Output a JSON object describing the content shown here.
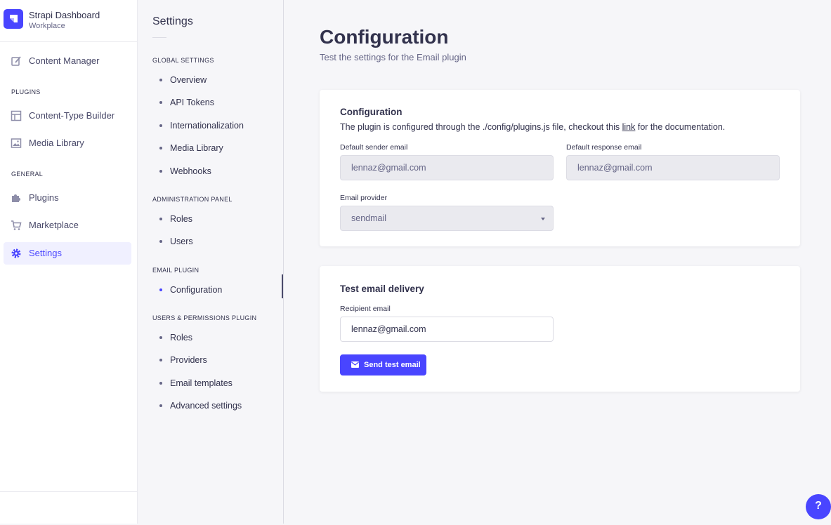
{
  "brand": {
    "title": "Strapi Dashboard",
    "subtitle": "Workplace",
    "icon": "strapi-logo-icon"
  },
  "mainnav": {
    "content_manager": "Content Manager",
    "plugins_section": "Plugins",
    "content_type_builder": "Content-Type Builder",
    "media_library": "Media Library",
    "general_section": "General",
    "plugins": "Plugins",
    "marketplace": "Marketplace",
    "settings": "Settings",
    "active": "Settings"
  },
  "subnav": {
    "title": "Settings",
    "global_section": "Global Settings",
    "overview": "Overview",
    "api_tokens": "API Tokens",
    "internationalization": "Internationalization",
    "media_library": "Media Library",
    "webhooks": "Webhooks",
    "admin_section": "Administration Panel",
    "admin_roles": "Roles",
    "admin_users": "Users",
    "email_section": "Email Plugin",
    "email_configuration": "Configuration",
    "up_section": "Users & Permissions Plugin",
    "up_roles": "Roles",
    "up_providers": "Providers",
    "up_email_templates": "Email templates",
    "up_advanced": "Advanced settings"
  },
  "page": {
    "title": "Configuration",
    "subtitle": "Test the settings for the Email plugin"
  },
  "config_card": {
    "heading": "Configuration",
    "desc_before": "The plugin is configured through the ./config/plugins.js file, checkout this ",
    "desc_link": "link",
    "desc_after": " for the documentation.",
    "sender_label": "Default sender email",
    "sender_value": "lennaz@gmail.com",
    "response_label": "Default response email",
    "response_value": "lennaz@gmail.com",
    "provider_label": "Email provider",
    "provider_value": "sendmail"
  },
  "test_card": {
    "heading": "Test email delivery",
    "recipient_label": "Recipient email",
    "recipient_value": "lennaz@gmail.com",
    "button_label": "Send test email"
  },
  "help": {
    "label": "?"
  },
  "colors": {
    "primary": "#4945ff",
    "background": "#f6f6f9",
    "text": "#32324d"
  }
}
